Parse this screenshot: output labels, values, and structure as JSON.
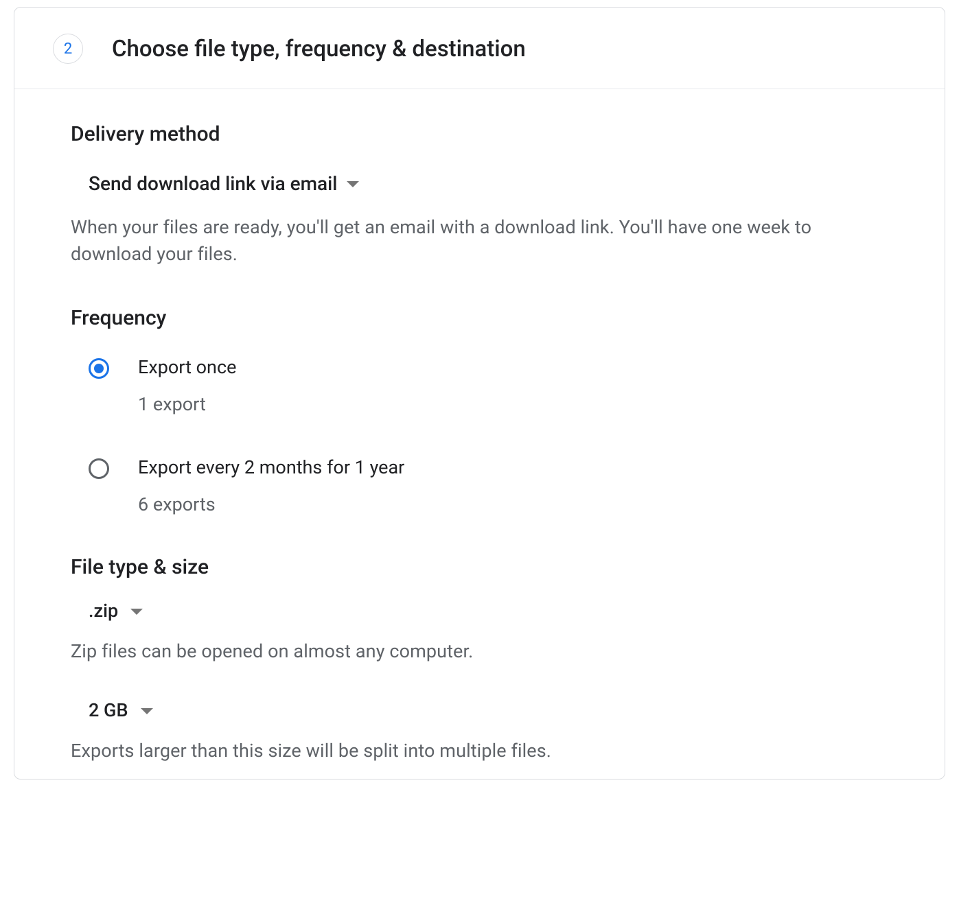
{
  "step": {
    "number": "2",
    "title": "Choose file type, frequency & destination"
  },
  "deliveryMethod": {
    "heading": "Delivery method",
    "selected": "Send download link via email",
    "description": "When your files are ready, you'll get an email with a download link. You'll have one week to download your files."
  },
  "frequency": {
    "heading": "Frequency",
    "options": [
      {
        "label": "Export once",
        "sublabel": "1 export",
        "selected": true
      },
      {
        "label": "Export every 2 months for 1 year",
        "sublabel": "6 exports",
        "selected": false
      }
    ]
  },
  "fileType": {
    "heading": "File type & size",
    "type": {
      "selected": ".zip",
      "description": "Zip files can be opened on almost any computer."
    },
    "size": {
      "selected": "2 GB",
      "description": "Exports larger than this size will be split into multiple files."
    }
  }
}
